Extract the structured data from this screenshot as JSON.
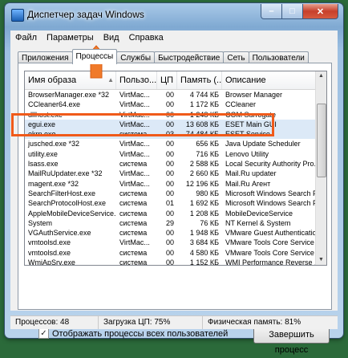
{
  "window": {
    "title": "Диспетчер задач Windows",
    "min": "–",
    "max": "□",
    "close": "✕"
  },
  "menu": [
    "Файл",
    "Параметры",
    "Вид",
    "Справка"
  ],
  "tabs": [
    "Приложения",
    "Процессы",
    "Службы",
    "Быстродействие",
    "Сеть",
    "Пользователи"
  ],
  "columns": {
    "name": "Имя образа",
    "user": "Пользо...",
    "cpu": "ЦП",
    "mem": "Память (...",
    "desc": "Описание",
    "sort_icon": "▲"
  },
  "rows": [
    {
      "name": "BrowserManager.exe *32",
      "user": "VirtMac...",
      "cpu": "00",
      "mem": "4 744 КБ",
      "desc": "Browser Manager"
    },
    {
      "name": "CCleaner64.exe",
      "user": "VirtMac...",
      "cpu": "00",
      "mem": "1 172 КБ",
      "desc": "CCleaner"
    },
    {
      "name": "dllhost.exe",
      "user": "VirtMac...",
      "cpu": "00",
      "mem": "1 248 КБ",
      "desc": "COM Surrogate"
    },
    {
      "name": "egui.exe",
      "user": "VirtMac...",
      "cpu": "00",
      "mem": "13 608 КБ",
      "desc": "ESET Main GUI"
    },
    {
      "name": "ekrn.exe",
      "user": "система",
      "cpu": "03",
      "mem": "74 484 КБ",
      "desc": "ESET Service"
    },
    {
      "name": "jusched.exe *32",
      "user": "VirtMac...",
      "cpu": "00",
      "mem": "656 КБ",
      "desc": "Java Update Scheduler"
    },
    {
      "name": "utility.exe",
      "user": "VirtMac...",
      "cpu": "00",
      "mem": "716 КБ",
      "desc": "Lenovo Utility"
    },
    {
      "name": "lsass.exe",
      "user": "система",
      "cpu": "00",
      "mem": "2 588 КБ",
      "desc": "Local Security Authority Pro..."
    },
    {
      "name": "MailRuUpdater.exe *32",
      "user": "VirtMac...",
      "cpu": "00",
      "mem": "2 660 КБ",
      "desc": "Mail.Ru updater"
    },
    {
      "name": "magent.exe *32",
      "user": "VirtMac...",
      "cpu": "00",
      "mem": "12 196 КБ",
      "desc": "Mail.Ru Агент"
    },
    {
      "name": "SearchFilterHost.exe",
      "user": "система",
      "cpu": "00",
      "mem": "980 КБ",
      "desc": "Microsoft Windows Search F..."
    },
    {
      "name": "SearchProtocolHost.exe",
      "user": "система",
      "cpu": "01",
      "mem": "1 692 КБ",
      "desc": "Microsoft Windows Search P..."
    },
    {
      "name": "AppleMobileDeviceService...",
      "user": "система",
      "cpu": "00",
      "mem": "1 208 КБ",
      "desc": "MobileDeviceService"
    },
    {
      "name": "System",
      "user": "система",
      "cpu": "29",
      "mem": "76 КБ",
      "desc": "NT Kernel & System"
    },
    {
      "name": "VGAuthService.exe",
      "user": "система",
      "cpu": "00",
      "mem": "1 948 КБ",
      "desc": "VMware Guest Authenticatio..."
    },
    {
      "name": "vmtoolsd.exe",
      "user": "VirtMac...",
      "cpu": "00",
      "mem": "3 684 КБ",
      "desc": "VMware Tools Core Service"
    },
    {
      "name": "vmtoolsd.exe",
      "user": "система",
      "cpu": "00",
      "mem": "4 580 КБ",
      "desc": "VMware Tools Core Service"
    },
    {
      "name": "WmiApSrv.exe",
      "user": "система",
      "cpu": "00",
      "mem": "1 152 КБ",
      "desc": "WMI Performance Reverse ..."
    }
  ],
  "show_all_checkbox": {
    "label": "Отображать процессы всех пользователей",
    "check": "✓"
  },
  "end_button": "Завершить процесс",
  "status": {
    "processes": "Процессов: 48",
    "cpu": "Загрузка ЦП: 75%",
    "memory": "Физическая память: 81%"
  },
  "colors": {
    "highlight": "#f05a1a",
    "arrow": "#f07a2a"
  }
}
